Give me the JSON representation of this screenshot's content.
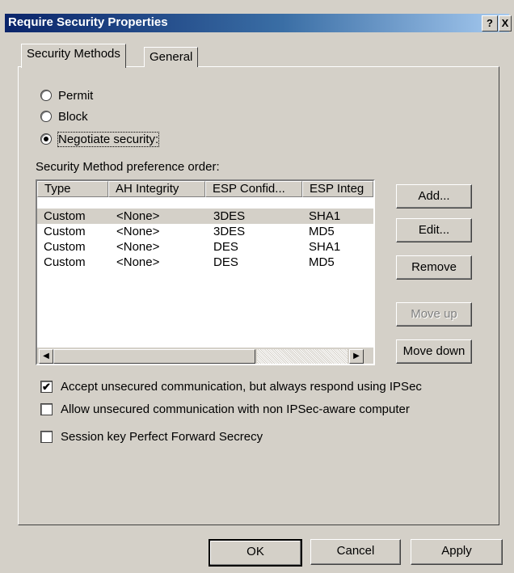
{
  "window": {
    "title": "Require Security Properties",
    "help_label": "?",
    "close_label": "X"
  },
  "tabs": [
    {
      "label": "Security Methods"
    },
    {
      "label": "General"
    }
  ],
  "radios": [
    {
      "label": "Permit",
      "checked": false
    },
    {
      "label": "Block",
      "checked": false
    },
    {
      "label": "Negotiate security:",
      "checked": true
    }
  ],
  "list": {
    "caption": "Security Method preference order:",
    "columns": [
      "Type",
      "AH Integrity",
      "ESP Confid...",
      "ESP Integ"
    ],
    "rows": [
      [
        "Custom",
        "<None>",
        "3DES",
        "SHA1"
      ],
      [
        "Custom",
        "<None>",
        "3DES",
        "MD5"
      ],
      [
        "Custom",
        "<None>",
        "DES",
        "SHA1"
      ],
      [
        "Custom",
        "<None>",
        "DES",
        "MD5"
      ]
    ],
    "selected_row": 0
  },
  "side_buttons": {
    "add": "Add...",
    "edit": "Edit...",
    "remove": "Remove",
    "move_up": "Move up",
    "move_down": "Move down"
  },
  "checkboxes": [
    {
      "label": "Accept unsecured communication, but always respond using IPSec",
      "checked": true
    },
    {
      "label": "Allow unsecured communication with non IPSec-aware computer",
      "checked": false
    },
    {
      "label": "Session key Perfect Forward Secrecy",
      "checked": false
    }
  ],
  "footer": {
    "ok": "OK",
    "cancel": "Cancel",
    "apply": "Apply"
  }
}
